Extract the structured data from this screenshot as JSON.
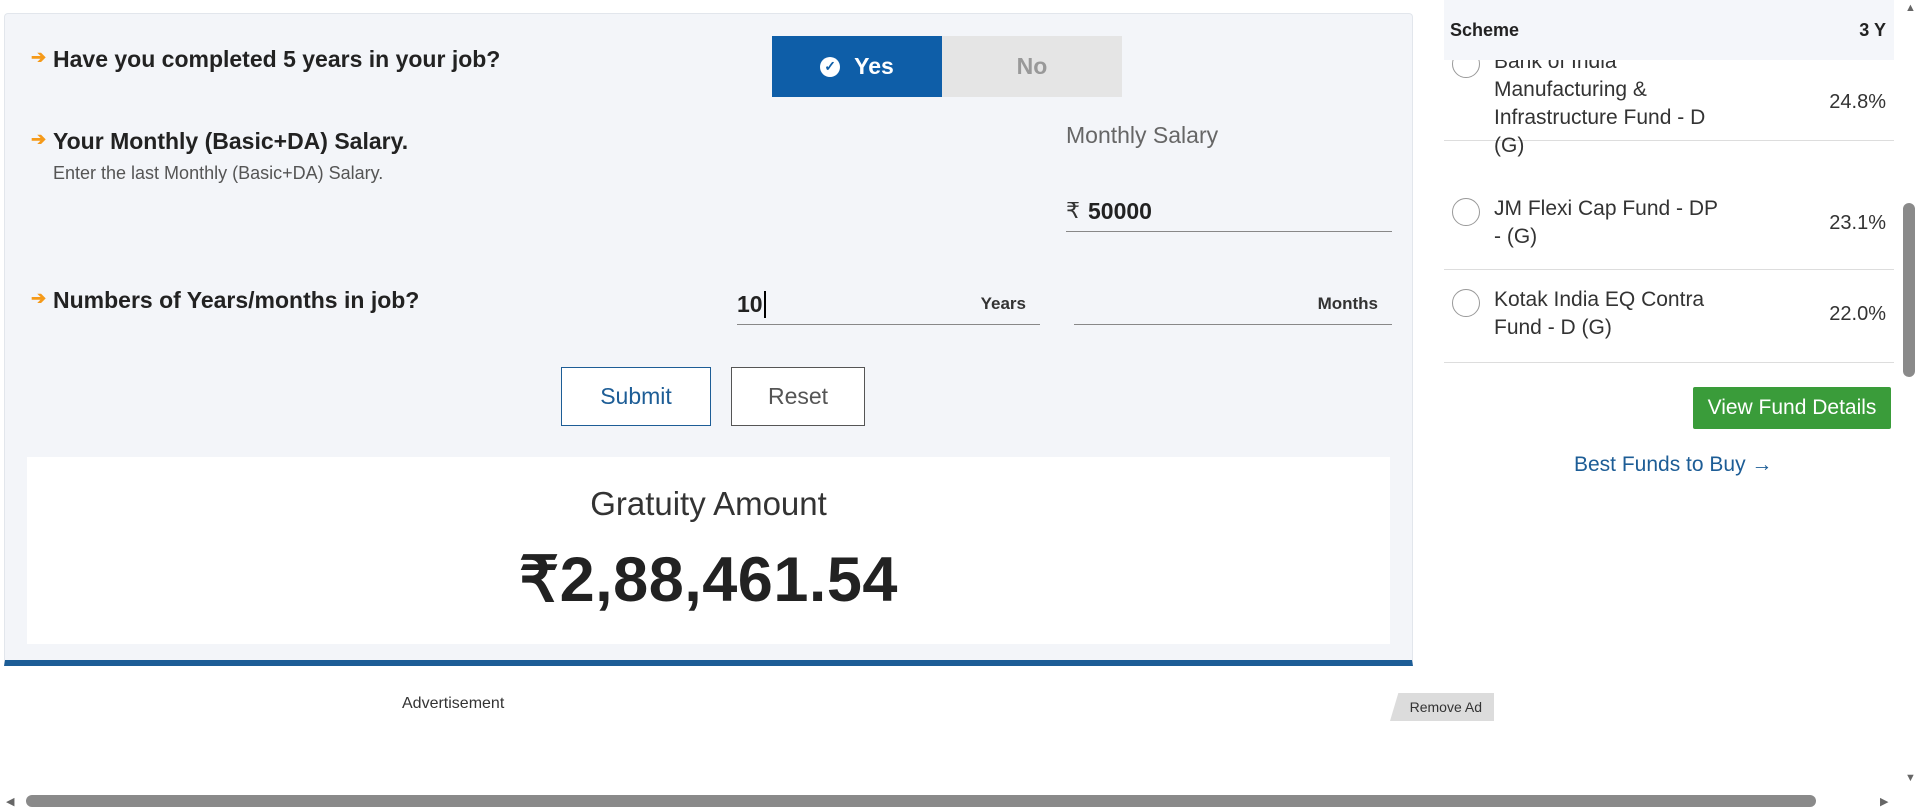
{
  "calculator": {
    "q1": {
      "text": "Have you completed 5 years in your job?"
    },
    "toggle": {
      "yes": "Yes",
      "no": "No",
      "selected": "Yes"
    },
    "q2": {
      "text": "Your Monthly (Basic+DA) Salary.",
      "sub": "Enter the last Monthly (Basic+DA) Salary."
    },
    "salary": {
      "label": "Monthly Salary",
      "currency": "₹",
      "value": "50000"
    },
    "q3": {
      "text": "Numbers of Years/months in job?"
    },
    "years": {
      "value": "10",
      "unit": "Years"
    },
    "months": {
      "value": "",
      "unit": "Months"
    },
    "buttons": {
      "submit": "Submit",
      "reset": "Reset"
    },
    "result": {
      "title": "Gratuity Amount",
      "amount": "₹2,88,461.54"
    }
  },
  "ad": {
    "label": "Advertisement",
    "remove": "Remove Ad"
  },
  "side": {
    "header": {
      "scheme": "Scheme",
      "period": "3 Y"
    },
    "funds": [
      {
        "name": "Bank of India Manufacturing & Infrastructure Fund - D (G)",
        "return": "24.8%"
      },
      {
        "name": "JM Flexi Cap Fund - DP - (G)",
        "return": "23.1%"
      },
      {
        "name": "Kotak India EQ Contra Fund - D (G)",
        "return": "22.0%"
      }
    ],
    "view_button": "View Fund Details",
    "best_link": "Best Funds to Buy →"
  },
  "colors": {
    "primary": "#0e5ea8",
    "accent_arrow": "#f59a1a",
    "green": "#3a9c3a"
  }
}
